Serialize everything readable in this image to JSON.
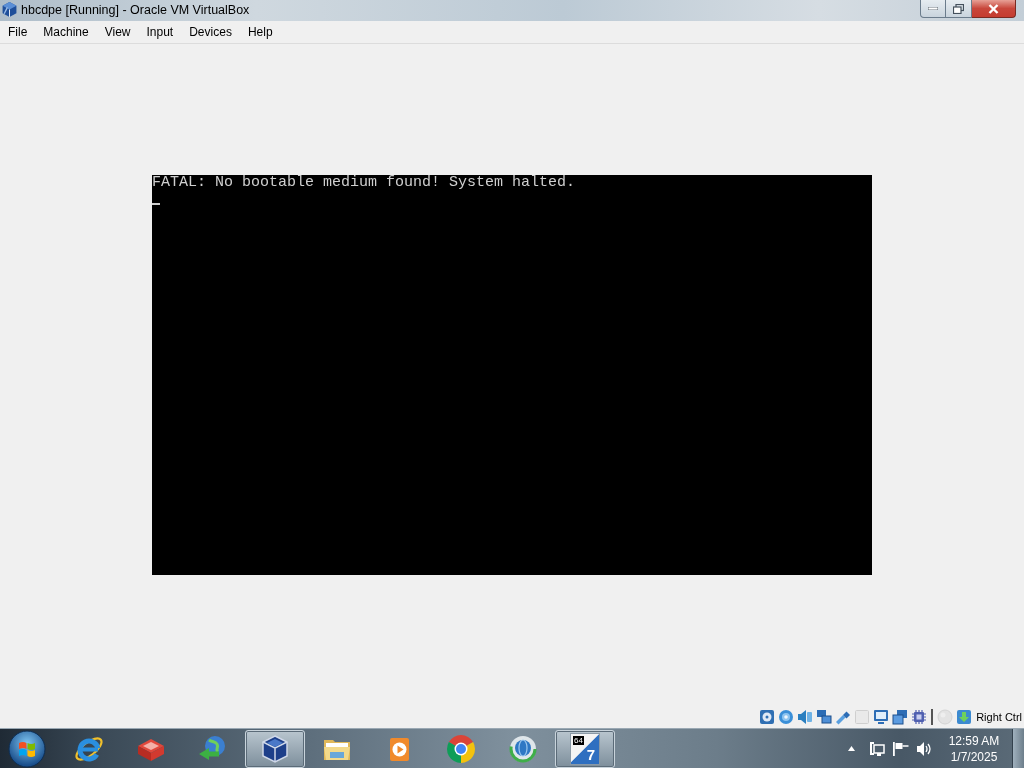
{
  "window": {
    "title": "hbcdpe [Running] - Oracle VM VirtualBox"
  },
  "menu": [
    "File",
    "Machine",
    "View",
    "Input",
    "Devices",
    "Help"
  ],
  "screen": {
    "lines": [
      "FATAL: No bootable medium found! System halted."
    ]
  },
  "status_bar": {
    "indicators": [
      {
        "kind": "hdd",
        "disabled": false
      },
      {
        "kind": "optical",
        "disabled": false
      },
      {
        "kind": "audio",
        "disabled": false
      },
      {
        "kind": "network",
        "disabled": false
      },
      {
        "kind": "usb",
        "disabled": false
      },
      {
        "kind": "shared",
        "disabled": true
      },
      {
        "kind": "display",
        "disabled": false
      },
      {
        "kind": "capture",
        "disabled": false
      },
      {
        "kind": "vtx",
        "disabled": false
      }
    ],
    "input_indicators": [
      {
        "kind": "mouse",
        "disabled": true
      },
      {
        "kind": "keyboard",
        "disabled": false
      }
    ],
    "host_key": "Right Ctrl"
  },
  "taskbar": {
    "apps": [
      {
        "kind": "ebrowser",
        "running": false
      },
      {
        "kind": "openbox",
        "running": false
      },
      {
        "kind": "downloader",
        "running": false
      },
      {
        "kind": "cube",
        "running": true
      },
      {
        "kind": "folder",
        "running": false
      },
      {
        "kind": "player",
        "running": false
      },
      {
        "kind": "segments",
        "running": false
      },
      {
        "kind": "globering",
        "running": false
      },
      {
        "kind": "tile",
        "running": true,
        "tile_texts": [
          "64",
          "7"
        ]
      }
    ],
    "clock": {
      "time": "12:59 AM",
      "date": "1/7/2025"
    }
  }
}
